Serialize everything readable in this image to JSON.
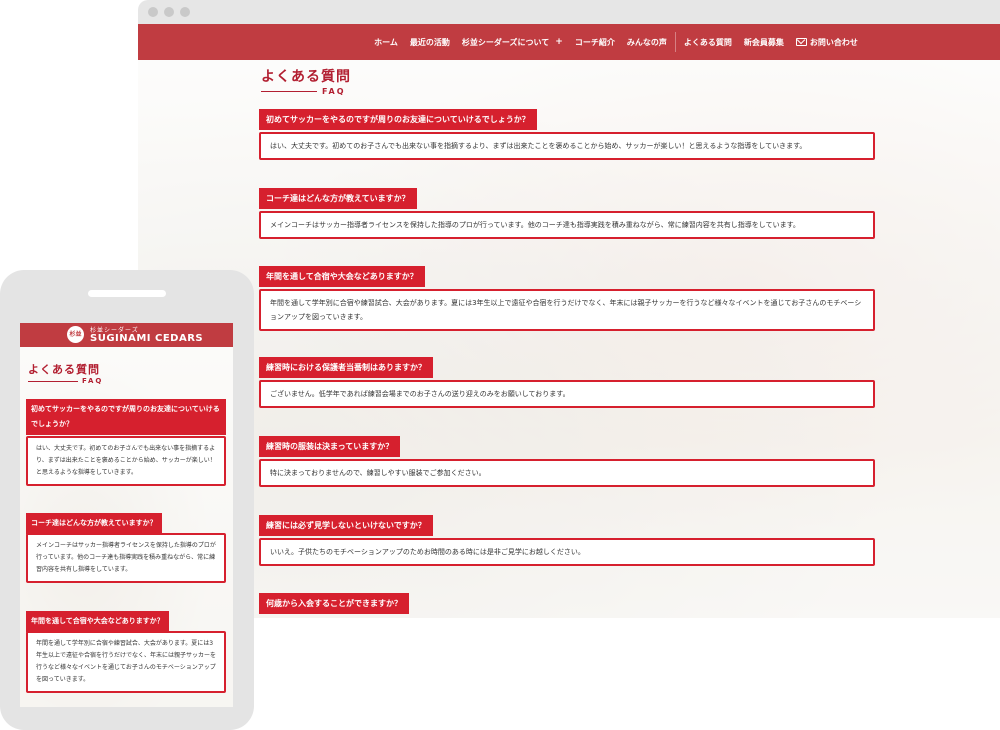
{
  "desktop": {
    "nav": {
      "items": [
        {
          "label": "ホーム"
        },
        {
          "label": "最近の活動"
        },
        {
          "label": "杉並シーダーズについて",
          "plus": "+"
        },
        {
          "label": "コーチ紹介"
        },
        {
          "label": "みんなの声"
        },
        {
          "label": "よくある質問"
        },
        {
          "label": "新会員募集"
        },
        {
          "label": "お問い合わせ",
          "icon": "mail-icon"
        }
      ]
    },
    "title": "よくある質問",
    "subtitle": "FAQ",
    "faqs": [
      {
        "q": "初めてサッカーをやるのですが周りのお友達についていけるでしょうか？",
        "a": "はい、大丈夫です。初めてのお子さんでも出来ない事を指摘するより、まずは出来たことを褒めることから始め、サッカーが楽しい！と思えるような指導をしていきます。"
      },
      {
        "q": "コーチ達はどんな方が教えていますか？",
        "a": "メインコーチはサッカー指導者ライセンスを保持した指導のプロが行っています。他のコーチ達も指導実践を積み重ねながら、常に練習内容を共有し指導をしています。"
      },
      {
        "q": "年間を通して合宿や大会などありますか？",
        "a": "年間を通して学年別に合宿や練習試合、大会があります。夏には3年生以上で遠征や合宿を行うだけでなく、年末には親子サッカーを行うなど様々なイベントを通じてお子さんのモチベーションアップを図っていきます。"
      },
      {
        "q": "練習時における保護者当番制はありますか？",
        "a": "ございません。低学年であれば練習会場までのお子さんの送り迎えのみをお願いしております。"
      },
      {
        "q": "練習時の服装は決まっていますか？",
        "a": "特に決まっておりませんので、練習しやすい服装でご参加ください。"
      },
      {
        "q": "練習には必ず見学しないといけないですか？",
        "a": "いいえ。子供たちのモチベーションアップのためお時間のある時には是非ご見学にお越しください。"
      },
      {
        "q": "何歳から入会することができますか？",
        "a": ""
      }
    ]
  },
  "mobile": {
    "logo": {
      "small": "杉並シーダーズ",
      "main": "SUGINAMI CEDARS",
      "mark": "杉並"
    },
    "title": "よくある質問",
    "subtitle": "FAQ",
    "faqs": [
      {
        "q": "初めてサッカーをやるのですが周りのお友達についていけるでしょうか？",
        "a": "はい、大丈夫です。初めてのお子さんでも出来ない事を指摘するより、まずは出来たことを褒めることから始め、サッカーが楽しい！と思えるような指導をしていきます。"
      },
      {
        "q": "コーチ達はどんな方が教えていますか？",
        "a": "メインコーチはサッカー指導者ライセンスを保持した指導のプロが行っています。他のコーチ達も指導実践を積み重ねながら、常に練習内容を共有し指導をしています。"
      },
      {
        "q": "年間を通して合宿や大会などありますか？",
        "a": "年間を通して学年別に合宿や練習試合、大会があります。夏には3年生以上で遠征や合宿を行うだけでなく、年末には親子サッカーを行うなど様々なイベントを通じてお子さんのモチベーションアップを図っていきます。"
      }
    ]
  },
  "colors": {
    "brand": "#c03c41",
    "accent": "#d6202e",
    "title": "#b21f31"
  }
}
